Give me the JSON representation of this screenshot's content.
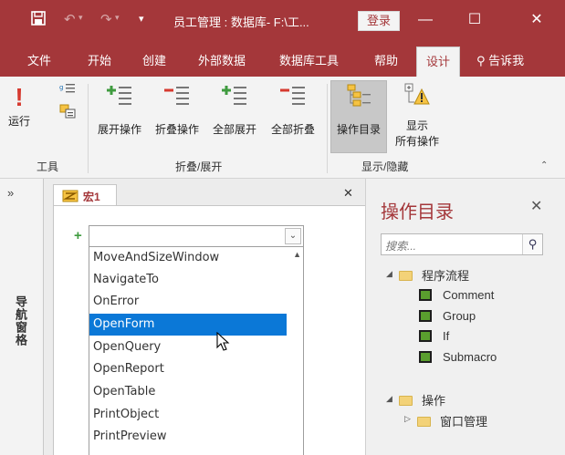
{
  "app": {
    "window_title": "员工管理 : 数据库- F:\\工...",
    "sign_in": "登录",
    "qa_save_icon": "save-icon",
    "qa_undo_icon": "undo-icon",
    "qa_redo_icon": "redo-icon",
    "qa_more": "▾",
    "win_min": "—",
    "win_max": "☐",
    "win_close": "✕"
  },
  "tabs": [
    "文件",
    "开始",
    "创建",
    "外部数据",
    "数据库工具",
    "帮助",
    "设计"
  ],
  "active_tab": "设计",
  "tell_me": "告诉我",
  "ribbon": {
    "groups": {
      "tools": "工具",
      "collapse_expand": "折叠/展开",
      "show_hide": "显示/隐藏"
    },
    "buttons": {
      "run": "运行",
      "expand_action": "展开操作",
      "collapse_action": "折叠操作",
      "expand_all": "全部展开",
      "collapse_all": "全部折叠",
      "action_catalog": "操作目录",
      "show_all_line1": "显示",
      "show_all_line2": "所有操作"
    }
  },
  "nav_pane": {
    "label": "导航窗格",
    "expand": "»"
  },
  "document": {
    "tab_name": "宏1",
    "close": "✕",
    "add": "+",
    "combo_arrow": "⌄",
    "scroll_up": "▲",
    "dropdown_items": [
      "MoveAndSizeWindow",
      "NavigateTo",
      "OnError",
      "OpenForm",
      "OpenQuery",
      "OpenReport",
      "OpenTable",
      "PrintObject",
      "PrintPreview"
    ],
    "selected_item": "OpenForm"
  },
  "catalog": {
    "title": "操作目录",
    "close": "✕",
    "search_placeholder": "搜索...",
    "program_flow": "程序流程",
    "flow_items": [
      "Comment",
      "Group",
      "If",
      "Submacro"
    ],
    "actions": "操作",
    "window_management": "窗口管理"
  }
}
